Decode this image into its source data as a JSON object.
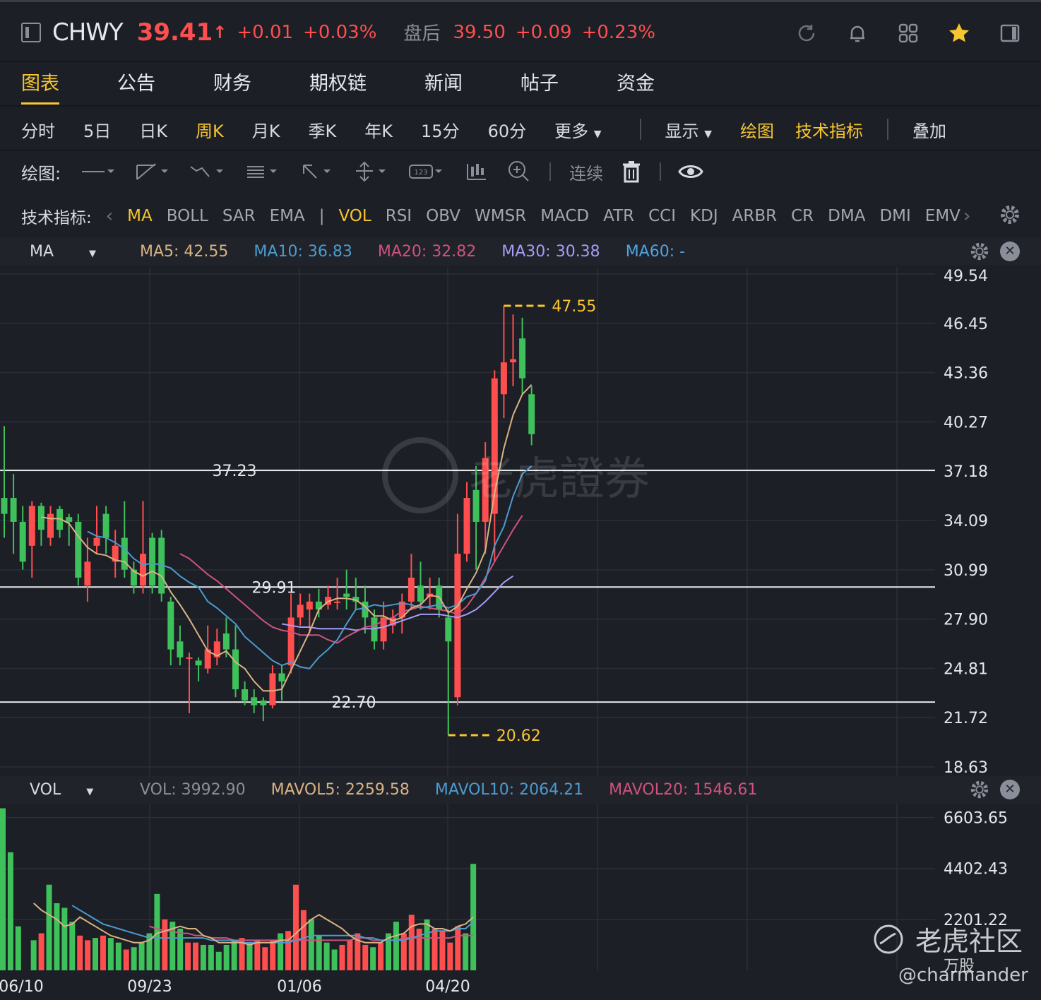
{
  "header": {
    "symbol": "CHWY",
    "price": "39.41",
    "price_arrow": "↑",
    "change": "+0.01",
    "change_pct": "+0.03%",
    "after_hours_label": "盘后",
    "after_hours_price": "39.50",
    "after_hours_change": "+0.09",
    "after_hours_change_pct": "+0.23%",
    "icons": [
      "refresh-icon",
      "bell-icon",
      "grid-icon",
      "star-icon",
      "panel-icon"
    ]
  },
  "tabs": [
    "图表",
    "公告",
    "财务",
    "期权链",
    "新闻",
    "帖子",
    "资金"
  ],
  "active_tab": "图表",
  "periods": [
    "分时",
    "5日",
    "日K",
    "周K",
    "月K",
    "季K",
    "年K",
    "15分",
    "60分",
    "更多"
  ],
  "active_period": "周K",
  "chart_options": {
    "display": "显示",
    "draw": "绘图",
    "indicators": "技术指标",
    "overlay": "叠加"
  },
  "draw_tools": {
    "label": "绘图:",
    "continuous": "连续"
  },
  "indicators_row": {
    "label": "技术指标:",
    "main": [
      "MA",
      "BOLL",
      "SAR",
      "EMA"
    ],
    "sub": [
      "VOL",
      "RSI",
      "OBV",
      "WMSR",
      "MACD",
      "ATR",
      "CCI",
      "KDJ",
      "ARBR",
      "CR",
      "DMA",
      "DMI",
      "EMV"
    ],
    "active_main": "MA",
    "active_sub": "VOL"
  },
  "ma_legend": {
    "title": "MA",
    "ma5": "MA5: 42.55",
    "ma10": "MA10: 36.83",
    "ma20": "MA20: 32.82",
    "ma30": "MA30: 30.38",
    "ma60": "MA60: -"
  },
  "vol_legend": {
    "title": "VOL",
    "vol": "VOL: 3992.90",
    "mavol5": "MAVOL5: 2259.58",
    "mavol10": "MAVOL10: 2064.21",
    "mavol20": "MAVOL20: 1546.61"
  },
  "colors": {
    "up": "#ff4e4e",
    "down": "#3ec15a",
    "ma5": "#d9b383",
    "ma10": "#4c9bd0",
    "ma20": "#d0527e",
    "ma30": "#a79cf5",
    "ma60": "#4fa3e0",
    "accent": "#f7c530"
  },
  "chart_data": {
    "type": "candlestick",
    "y_ticks": [
      "49.54",
      "46.45",
      "43.36",
      "40.27",
      "37.18",
      "34.09",
      "30.99",
      "27.90",
      "24.81",
      "21.72",
      "18.63"
    ],
    "ylim": [
      18.63,
      49.54
    ],
    "x_ticks": [
      "06/10",
      "09/23",
      "01/06",
      "04/20"
    ],
    "high_marker": "47.55",
    "low_marker": "20.62",
    "horizontal_lines": [
      "37.23",
      "29.91",
      "22.70"
    ],
    "candles": [
      {
        "o": 35.5,
        "c": 34.5,
        "h": 40.0,
        "l": 33.0
      },
      {
        "o": 35.5,
        "c": 34.0,
        "h": 37.0,
        "l": 32.0
      },
      {
        "o": 34.0,
        "c": 31.5,
        "h": 35.0,
        "l": 31.0
      },
      {
        "o": 32.5,
        "c": 35.0,
        "h": 35.3,
        "l": 30.5
      },
      {
        "o": 35.0,
        "c": 33.5,
        "h": 35.2,
        "l": 32.5
      },
      {
        "o": 33.0,
        "c": 34.5,
        "h": 35.0,
        "l": 32.5
      },
      {
        "o": 34.8,
        "c": 33.5,
        "h": 35.0,
        "l": 33.0
      },
      {
        "o": 34.3,
        "c": 34.0,
        "h": 34.5,
        "l": 32.5
      },
      {
        "o": 34.0,
        "c": 30.5,
        "h": 34.5,
        "l": 30.0
      },
      {
        "o": 30.0,
        "c": 31.5,
        "h": 33.0,
        "l": 29.0
      },
      {
        "o": 32.5,
        "c": 33.0,
        "h": 35.0,
        "l": 32.0
      },
      {
        "o": 34.5,
        "c": 33.0,
        "h": 35.0,
        "l": 32.0
      },
      {
        "o": 31.5,
        "c": 32.5,
        "h": 33.5,
        "l": 30.5
      },
      {
        "o": 33.0,
        "c": 31.0,
        "h": 35.3,
        "l": 30.5
      },
      {
        "o": 31.0,
        "c": 30.0,
        "h": 31.5,
        "l": 29.5
      },
      {
        "o": 30.0,
        "c": 32.0,
        "h": 35.3,
        "l": 29.5
      },
      {
        "o": 33.0,
        "c": 30.0,
        "h": 33.3,
        "l": 29.5
      },
      {
        "o": 33.0,
        "c": 29.5,
        "h": 33.5,
        "l": 29.0
      },
      {
        "o": 29.0,
        "c": 26.0,
        "h": 29.3,
        "l": 25.0
      },
      {
        "o": 26.5,
        "c": 25.5,
        "h": 27.5,
        "l": 25.0
      },
      {
        "o": 25.5,
        "c": 25.5,
        "h": 25.8,
        "l": 22.0
      },
      {
        "o": 25.3,
        "c": 25.0,
        "h": 25.5,
        "l": 24.0
      },
      {
        "o": 24.8,
        "c": 26.0,
        "h": 27.5,
        "l": 24.5
      },
      {
        "o": 25.5,
        "c": 26.5,
        "h": 27.3,
        "l": 25.0
      },
      {
        "o": 27.0,
        "c": 26.0,
        "h": 28.0,
        "l": 25.5
      },
      {
        "o": 26.0,
        "c": 23.5,
        "h": 27.5,
        "l": 23.0
      },
      {
        "o": 23.5,
        "c": 22.8,
        "h": 24.0,
        "l": 22.5
      },
      {
        "o": 23.0,
        "c": 22.5,
        "h": 23.5,
        "l": 22.0
      },
      {
        "o": 22.8,
        "c": 22.5,
        "h": 23.0,
        "l": 21.5
      },
      {
        "o": 22.5,
        "c": 24.5,
        "h": 25.0,
        "l": 22.3
      },
      {
        "o": 24.5,
        "c": 24.0,
        "h": 25.0,
        "l": 22.8
      },
      {
        "o": 25.0,
        "c": 28.0,
        "h": 29.5,
        "l": 24.5
      },
      {
        "o": 28.0,
        "c": 28.8,
        "h": 29.5,
        "l": 27.5
      },
      {
        "o": 28.5,
        "c": 29.0,
        "h": 29.5,
        "l": 27.0
      },
      {
        "o": 29.0,
        "c": 28.5,
        "h": 29.8,
        "l": 28.0
      },
      {
        "o": 28.8,
        "c": 29.3,
        "h": 30.0,
        "l": 28.5
      },
      {
        "o": 29.0,
        "c": 29.0,
        "h": 30.5,
        "l": 28.5
      },
      {
        "o": 29.5,
        "c": 29.3,
        "h": 31.0,
        "l": 28.5
      },
      {
        "o": 29.3,
        "c": 29.0,
        "h": 30.5,
        "l": 28.5
      },
      {
        "o": 29.0,
        "c": 28.0,
        "h": 30.0,
        "l": 27.0
      },
      {
        "o": 28.0,
        "c": 26.5,
        "h": 28.5,
        "l": 26.0
      },
      {
        "o": 26.5,
        "c": 28.0,
        "h": 29.0,
        "l": 26.0
      },
      {
        "o": 27.5,
        "c": 28.0,
        "h": 28.5,
        "l": 27.0
      },
      {
        "o": 28.0,
        "c": 29.0,
        "h": 29.5,
        "l": 27.0
      },
      {
        "o": 29.0,
        "c": 30.5,
        "h": 32.0,
        "l": 28.5
      },
      {
        "o": 30.0,
        "c": 29.0,
        "h": 31.5,
        "l": 28.5
      },
      {
        "o": 29.3,
        "c": 29.5,
        "h": 30.5,
        "l": 28.5
      },
      {
        "o": 30.0,
        "c": 28.5,
        "h": 30.5,
        "l": 28.0
      },
      {
        "o": 28.0,
        "c": 26.5,
        "h": 28.5,
        "l": 20.62
      },
      {
        "o": 23.0,
        "c": 32.0,
        "h": 34.5,
        "l": 22.5
      },
      {
        "o": 32.0,
        "c": 35.5,
        "h": 36.5,
        "l": 31.5
      },
      {
        "o": 36.0,
        "c": 34.0,
        "h": 37.5,
        "l": 31.0
      },
      {
        "o": 34.0,
        "c": 38.0,
        "h": 39.0,
        "l": 32.0
      },
      {
        "o": 34.5,
        "c": 43.0,
        "h": 43.5,
        "l": 31.5
      },
      {
        "o": 42.0,
        "c": 44.0,
        "h": 47.55,
        "l": 40.5
      },
      {
        "o": 44.0,
        "c": 44.2,
        "h": 47.0,
        "l": 42.5
      },
      {
        "o": 45.5,
        "c": 43.0,
        "h": 46.8,
        "l": 42.0
      },
      {
        "o": 42.0,
        "c": 39.5,
        "h": 42.5,
        "l": 38.8
      }
    ],
    "ma5": [
      null,
      null,
      null,
      null,
      34.3,
      34.2,
      34.2,
      33.9,
      33.1,
      32.4,
      32.0,
      31.9,
      31.6,
      31.5,
      30.9,
      30.6,
      30.9,
      30.6,
      29.6,
      28.8,
      27.9,
      26.9,
      25.9,
      25.6,
      25.9,
      25.2,
      24.8,
      24.0,
      23.4,
      23.4,
      23.5,
      24.7,
      25.9,
      27.1,
      28.5,
      29.0,
      29.2,
      29.2,
      29.1,
      28.7,
      28.1,
      28.1,
      27.8,
      28.0,
      28.6,
      28.8,
      29.4,
      29.3,
      28.3,
      28.7,
      29.8,
      30.8,
      32.2,
      35.8,
      38.6,
      40.7,
      42.0,
      42.6
    ],
    "ma10": [
      null,
      null,
      null,
      null,
      null,
      null,
      null,
      null,
      null,
      33.4,
      33.1,
      33.0,
      32.7,
      32.3,
      31.7,
      31.3,
      31.4,
      31.3,
      31.1,
      30.6,
      30.2,
      29.9,
      29.0,
      28.6,
      28.1,
      27.6,
      26.8,
      26.3,
      25.8,
      25.3,
      25.0,
      25.2,
      24.9,
      24.8,
      25.5,
      26.0,
      26.6,
      27.6,
      28.5,
      28.6,
      28.8,
      28.7,
      28.8,
      28.9,
      28.8,
      28.6,
      28.7,
      28.8,
      28.6,
      28.8,
      29.3,
      29.5,
      30.3,
      32.5,
      33.7,
      35.6,
      37.0,
      37.5
    ],
    "ma20": [
      null,
      null,
      null,
      null,
      null,
      null,
      null,
      null,
      null,
      null,
      null,
      null,
      null,
      null,
      null,
      null,
      null,
      null,
      null,
      32.0,
      31.7,
      31.2,
      30.7,
      30.3,
      29.8,
      29.3,
      28.8,
      28.3,
      27.8,
      27.4,
      27.2,
      27.1,
      26.9,
      26.9,
      26.9,
      26.6,
      26.4,
      26.8,
      27.1,
      27.4,
      27.5,
      27.8,
      28.0,
      28.4,
      28.5,
      28.7,
      28.6,
      28.5,
      28.4,
      28.2,
      28.7,
      29.5,
      30.5,
      31.5,
      32.5,
      33.5,
      34.4
    ],
    "ma30": [
      null,
      null,
      null,
      null,
      null,
      null,
      null,
      null,
      null,
      null,
      null,
      null,
      null,
      null,
      null,
      null,
      null,
      null,
      null,
      null,
      null,
      null,
      null,
      null,
      null,
      null,
      null,
      null,
      null,
      null,
      27.6,
      27.5,
      27.4,
      27.4,
      27.3,
      27.3,
      27.3,
      27.3,
      27.2,
      27.3,
      27.3,
      27.4,
      27.6,
      27.8,
      28.0,
      28.2,
      28.2,
      28.2,
      28.1,
      28.0,
      28.2,
      28.5,
      29.0,
      29.6,
      30.2,
      30.6
    ],
    "volumes": [
      7000,
      5100,
      1900,
      0,
      1300,
      1600,
      3700,
      2900,
      2700,
      2100,
      1500,
      1300,
      1400,
      1500,
      1400,
      1200,
      900,
      1000,
      1200,
      1600,
      3300,
      2200,
      2100,
      1800,
      1200,
      1200,
      1100,
      1100,
      800,
      1100,
      1300,
      1400,
      1200,
      1300,
      1000,
      1300,
      1600,
      1700,
      3700,
      2600,
      2200,
      1500,
      1200,
      900,
      1100,
      1300,
      1600,
      1100,
      1000,
      1200,
      1600,
      2100,
      1600,
      2400,
      1800,
      2200,
      1800,
      1700,
      1200,
      1900,
      1600,
      4600
    ],
    "mavol5": [
      null,
      null,
      null,
      null,
      2900,
      2600,
      2400,
      2200,
      1900,
      2000,
      2300,
      2100,
      1900,
      1700,
      1500,
      1400,
      1300,
      1200,
      1200,
      1300,
      1600,
      1700,
      1800,
      1900,
      1800,
      1800,
      1500,
      1400,
      1200,
      1200,
      1200,
      1200,
      1100,
      1200,
      1200,
      1200,
      1300,
      1300,
      1600,
      1900,
      2200,
      2400,
      2200,
      2000,
      1800,
      1500,
      1300,
      1200,
      1200,
      1200,
      1400,
      1500,
      1600,
      1900,
      2000,
      2000,
      1800,
      1800,
      1700,
      1900,
      2000,
      2300
    ],
    "mavol10": [
      null,
      null,
      null,
      null,
      null,
      null,
      null,
      null,
      null,
      2800,
      2600,
      2400,
      2200,
      2000,
      1900,
      1800,
      1700,
      1600,
      1500,
      1400,
      1400,
      1400,
      1400,
      1400,
      1400,
      1400,
      1400,
      1300,
      1300,
      1300,
      1300,
      1200,
      1200,
      1200,
      1200,
      1200,
      1200,
      1200,
      1300,
      1400,
      1500,
      1500,
      1500,
      1500,
      1500,
      1500,
      1500,
      1400,
      1400,
      1300,
      1300,
      1300,
      1300,
      1400,
      1500,
      1600,
      1700,
      1700,
      1700,
      1800,
      1800,
      2100
    ],
    "mavol20": [
      null,
      null,
      null,
      null,
      null,
      null,
      null,
      null,
      null,
      null,
      null,
      null,
      null,
      null,
      null,
      null,
      null,
      null,
      null,
      1900,
      1800,
      1700,
      1700,
      1600,
      1600,
      1500,
      1500,
      1400,
      1400,
      1400,
      1300,
      1300,
      1300,
      1300,
      1300,
      1300,
      1300,
      1300,
      1300,
      1300,
      1300,
      1300,
      1300,
      1300,
      1300,
      1300,
      1400,
      1400,
      1300,
      1300,
      1300,
      1300,
      1400,
      1400,
      1400,
      1400,
      1400,
      1400,
      1400,
      1500,
      1500,
      1500
    ],
    "vol_ticks": [
      "6603.65",
      "4402.43",
      "2201.22"
    ],
    "vol_ylim": [
      0,
      7200
    ]
  },
  "watermarks": {
    "center": "老虎證券",
    "community": "老虎社区",
    "sub": "万股",
    "user": "@charmander"
  }
}
